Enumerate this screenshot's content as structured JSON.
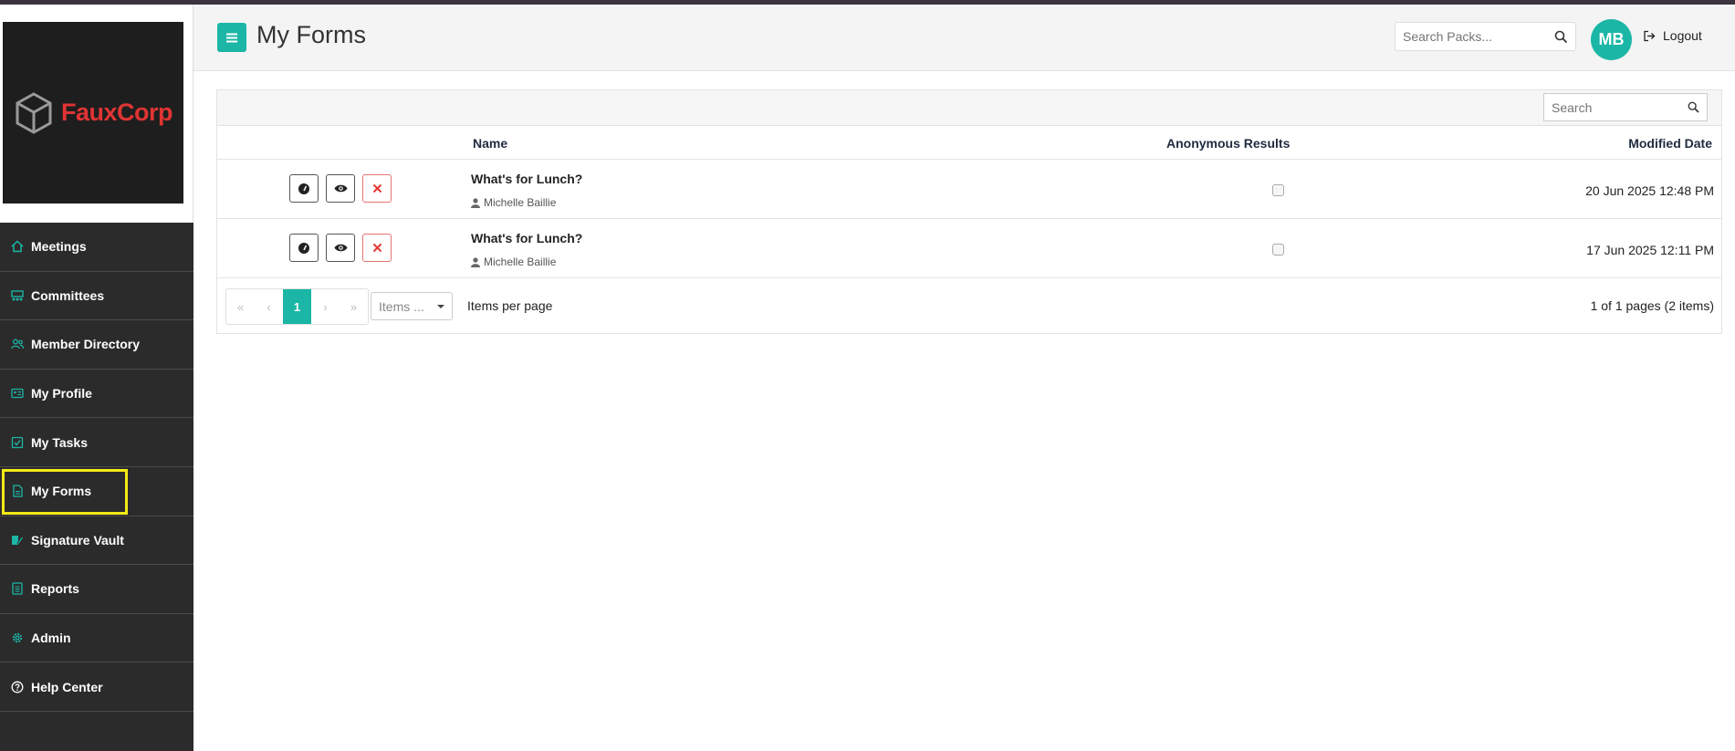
{
  "app": {
    "logo_text": "FauxCorp"
  },
  "sidebar": {
    "items": [
      {
        "label": "Meetings",
        "icon": "home-icon"
      },
      {
        "label": "Committees",
        "icon": "committee-icon"
      },
      {
        "label": "Member Directory",
        "icon": "users-icon"
      },
      {
        "label": "My Profile",
        "icon": "id-card-icon"
      },
      {
        "label": "My Tasks",
        "icon": "check-square-icon"
      },
      {
        "label": "My Forms",
        "icon": "file-icon",
        "active": true
      },
      {
        "label": "Signature Vault",
        "icon": "signature-icon"
      },
      {
        "label": "Reports",
        "icon": "report-icon"
      },
      {
        "label": "Admin",
        "icon": "gear-icon"
      },
      {
        "label": "Help Center",
        "icon": "help-circle-icon"
      }
    ]
  },
  "header": {
    "title": "My Forms",
    "search_placeholder": "Search Packs...",
    "avatar_initials": "MB",
    "logout_label": "Logout"
  },
  "grid": {
    "search_placeholder": "Search",
    "columns": {
      "name": "Name",
      "anonymous": "Anonymous Results",
      "modified": "Modified Date"
    },
    "rows": [
      {
        "name": "What's for Lunch?",
        "author": "Michelle Baillie",
        "anonymous": false,
        "modified": "20 Jun 2025 12:48 PM"
      },
      {
        "name": "What's for Lunch?",
        "author": "Michelle Baillie",
        "anonymous": false,
        "modified": "17 Jun 2025 12:11 PM"
      }
    ],
    "pager": {
      "current_page": "1",
      "items_select": "Items ...",
      "items_per_page_label": "Items per page",
      "info": "1 of 1 pages (2 items)"
    }
  },
  "colors": {
    "accent": "#1bb6a6",
    "sidebar_bg": "#2b2b2b",
    "highlight": "#f2ea16",
    "delete": "#e53935"
  }
}
